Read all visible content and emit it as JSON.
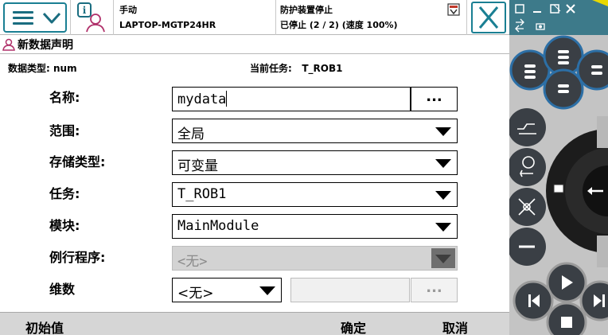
{
  "header": {
    "mode": "手动",
    "host": "LAPTOP-MGTP24HR",
    "status_title": "防护装置停止",
    "status_detail": "已停止 (2 / 2) (速度 100%)"
  },
  "page": {
    "title": "新数据声明",
    "data_type_label": "数据类型: num",
    "current_task_label": "当前任务:",
    "current_task_value": "T_ROB1"
  },
  "form": {
    "name": {
      "label": "名称:",
      "value": "mydata",
      "button": "..."
    },
    "scope": {
      "label": "范围:",
      "value": "全局"
    },
    "storage": {
      "label": "存储类型:",
      "value": "可变量"
    },
    "task": {
      "label": "任务:",
      "value": "T_ROB1"
    },
    "module": {
      "label": "模块:",
      "value": "MainModule"
    },
    "routine": {
      "label": "例行程序:",
      "value": "<无>",
      "disabled": true
    },
    "dimension": {
      "label": "维数",
      "value": "<无>",
      "button": "..."
    }
  },
  "footer": {
    "initial_value": "初始值",
    "ok": "确定",
    "cancel": "取消"
  },
  "colors": {
    "accent": "#1a7f93",
    "panel_teal": "#3d7a8a",
    "panel_button": "#3a3f45",
    "button_ring": "#2c6fa6"
  },
  "icons": [
    "menu-icon",
    "info-user-icon",
    "status-icon",
    "close-icon",
    "data-declaration-icon",
    "play-icon",
    "step-back-icon",
    "step-forward-icon",
    "stop-icon"
  ]
}
